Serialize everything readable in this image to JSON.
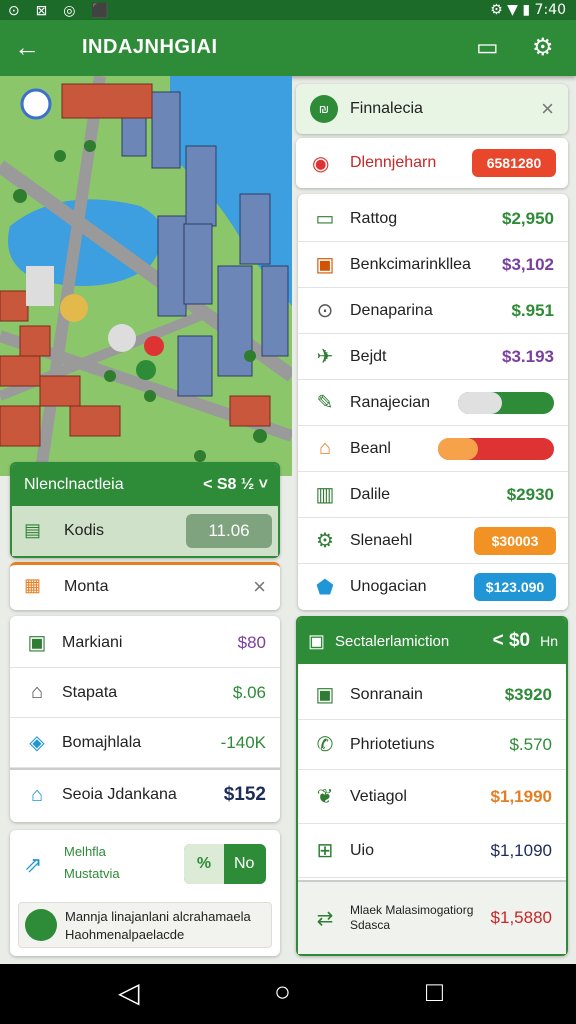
{
  "status": {
    "left_icons": "⊙ ⊠ ◎ ⬛",
    "time": "7:40"
  },
  "appbar": {
    "title": "INDAJNHGIAI"
  },
  "right_panel": {
    "header": {
      "label": "Finnalecia"
    },
    "highlight": {
      "label": "Dlennjeharn",
      "value": "6581280"
    },
    "items": [
      {
        "label": "Rattog",
        "value": "$2,950",
        "color": "#2e8b37"
      },
      {
        "label": "Benkcimarinkllea",
        "value": "$3,102",
        "color": "#7b3fa0"
      },
      {
        "label": "Denaparina",
        "value": "$.951",
        "color": "#2e8b37"
      },
      {
        "label": "Bejdt",
        "value": "$3.193",
        "color": "#7b3fa0"
      }
    ],
    "toggle_label": "Ranajecian",
    "bar_label": "Beanl",
    "items2": [
      {
        "label": "Dalile",
        "value": "$2930",
        "color": "#2e8b37"
      },
      {
        "label": "Slenaehl",
        "value": "$30003",
        "pill": "#f39224"
      },
      {
        "label": "Unogacian",
        "value": "$123.090",
        "pill": "#2196d6"
      }
    ]
  },
  "left_panel": {
    "header": {
      "label": "Nlenclnactleia",
      "value": "< S8 ½ ˅"
    },
    "kodis": {
      "label": "Kodis",
      "value": "11.06"
    },
    "monta": {
      "label": "Monta"
    },
    "items": [
      {
        "label": "Markiani",
        "value": "$80",
        "color": "#7b3fa0"
      },
      {
        "label": "Stapata",
        "value": "$.06",
        "color": "#2e8b37"
      },
      {
        "label": "Bomajhlala",
        "value": "-140K",
        "color": "#2e8b37"
      },
      {
        "label": "Seoia Jdankana",
        "value": "$152",
        "color": "#1c2b5a"
      }
    ],
    "promo": {
      "line1": "Melhfla",
      "line2": "Mustatvia",
      "button": "No"
    },
    "user": {
      "line1": "Mannja linajanlani alcrahamaela",
      "line2": "Haohmenalpaelacde"
    }
  },
  "bottom_right": {
    "header": {
      "label": "Sectalerlamiction",
      "value": "< $0",
      "extra": "Hn"
    },
    "items": [
      {
        "label": "Sonranain",
        "value": "$3920",
        "color": "#2e8b37"
      },
      {
        "label": "Phriotetiuns",
        "value": "$.570",
        "color": "#2e8b37"
      },
      {
        "label": "Vetiagol",
        "value": "$1,1990",
        "color": "#e67e22"
      },
      {
        "label": "Uio",
        "value": "$1,1090",
        "color": "#1c2b5a"
      },
      {
        "label": "Mlaek Malasimogatiorg Sdasca",
        "value": "$1,5880",
        "color": "#c62828"
      }
    ]
  }
}
